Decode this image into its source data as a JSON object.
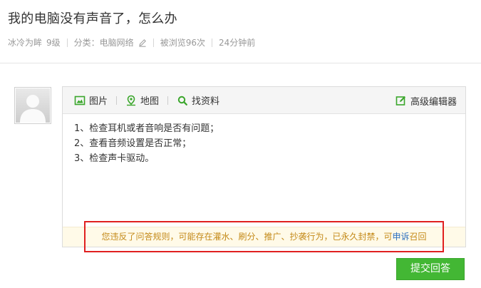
{
  "question": {
    "title": "我的电脑没有声音了，怎么办",
    "author": "冰冷为眸",
    "level": "9级",
    "category_label": "分类：",
    "category": "电脑网络",
    "views": "被浏览96次",
    "time": "24分钟前"
  },
  "editor": {
    "toolbar": {
      "image": "图片",
      "map": "地图",
      "search": "找资料",
      "advanced": "高级编辑器"
    },
    "lines": [
      "1、检查耳机或者音响是否有问题；",
      "2、查看音频设置是否正常；",
      "3、检查声卡驱动。"
    ],
    "notice": {
      "text": "您违反了问答规则，可能存在灌水、刷分、推广、抄袭行为，已永久封禁，可",
      "appeal_link": "申诉",
      "suffix": "召回"
    }
  },
  "submit_label": "提交回答",
  "colors": {
    "accent_green": "#43b734",
    "icon_green": "#3aa62b",
    "notice_text": "#c48a19",
    "link_blue": "#2d6fbf",
    "highlight_red": "#e02020"
  }
}
